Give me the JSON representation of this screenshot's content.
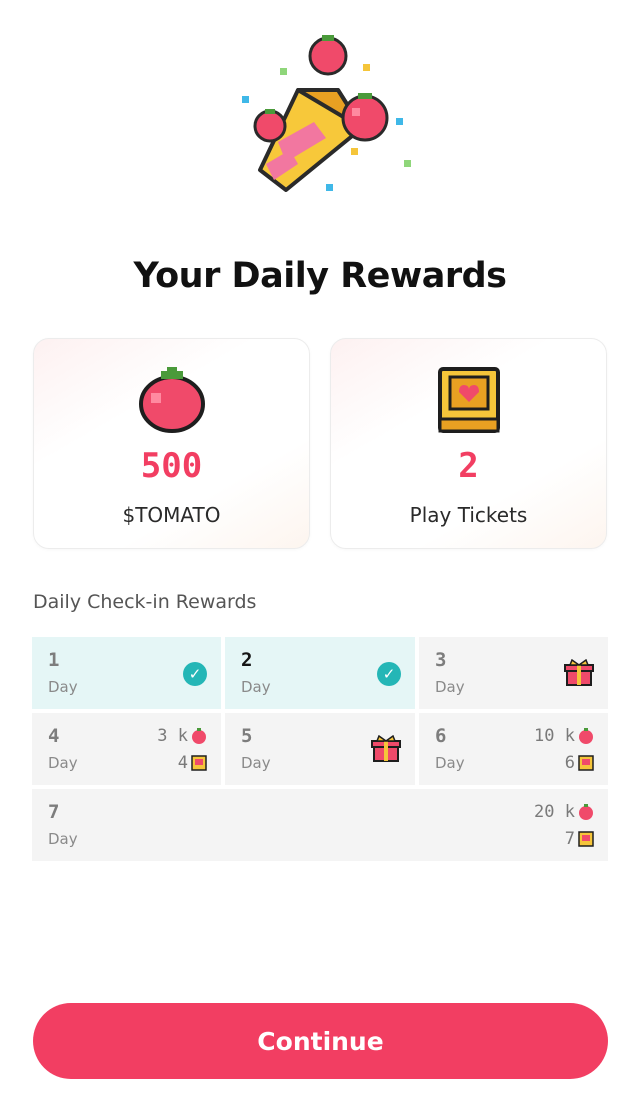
{
  "title": "Your Daily Rewards",
  "colors": {
    "accent": "#f23e62",
    "check": "#24b6b6",
    "claimed_bg": "#e5f6f6",
    "cell_bg": "#f4f4f4"
  },
  "rewards": [
    {
      "amount": "500",
      "label": "$TOMATO",
      "icon": "tomato-icon"
    },
    {
      "amount": "2",
      "label": "Play Tickets",
      "icon": "ticket-icon"
    }
  ],
  "checkin": {
    "title": "Daily Check-in Rewards",
    "days": [
      {
        "num": "1",
        "day_label": "Day",
        "status": "claimed"
      },
      {
        "num": "2",
        "day_label": "Day",
        "status": "claimed"
      },
      {
        "num": "3",
        "day_label": "Day",
        "status": "gift"
      },
      {
        "num": "4",
        "day_label": "Day",
        "tomato": "3 k",
        "tickets": "4"
      },
      {
        "num": "5",
        "day_label": "Day",
        "status": "gift"
      },
      {
        "num": "6",
        "day_label": "Day",
        "tomato": "10 k",
        "tickets": "6"
      },
      {
        "num": "7",
        "day_label": "Day",
        "tomato": "20 k",
        "tickets": "7"
      }
    ]
  },
  "continue_label": "Continue"
}
